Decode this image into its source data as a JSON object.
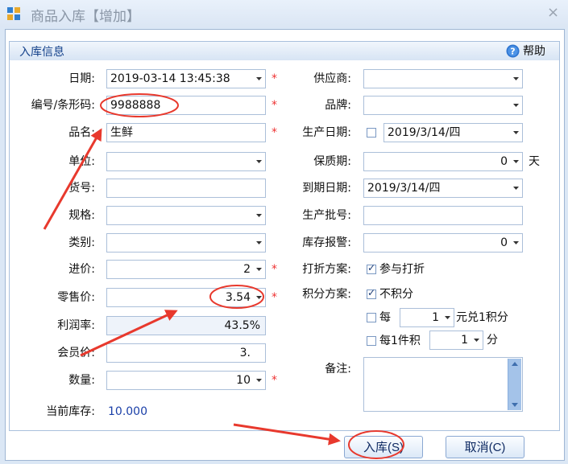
{
  "window": {
    "title": "商品入库【增加】",
    "close_glyph": "×"
  },
  "group": {
    "title": "入库信息",
    "help_label": "帮助"
  },
  "required_mark": "*",
  "left": {
    "date": {
      "label": "日期:",
      "value": "2019-03-14 13:45:38"
    },
    "barcode": {
      "label": "编号/条形码:",
      "value": "9988888"
    },
    "name": {
      "label": "品名:",
      "value": "生鲜"
    },
    "unit": {
      "label": "单位:",
      "value": ""
    },
    "item_no": {
      "label": "货号:",
      "value": ""
    },
    "spec": {
      "label": "规格:",
      "value": ""
    },
    "category": {
      "label": "类别:",
      "value": ""
    },
    "cost_price": {
      "label": "进价:",
      "value": "2"
    },
    "retail_price": {
      "label": "零售价:",
      "value": "3.54"
    },
    "profit_rate": {
      "label": "利润率:",
      "value": "43.5%"
    },
    "member_price": {
      "label": "会员价:",
      "value": "3."
    },
    "quantity": {
      "label": "数量:",
      "value": "10"
    },
    "current_stock": {
      "label": "当前库存:",
      "value": "10.000"
    }
  },
  "right": {
    "supplier": {
      "label": "供应商:",
      "value": ""
    },
    "brand": {
      "label": "品牌:",
      "value": ""
    },
    "production_date": {
      "label": "生产日期:",
      "value": "2019/3/14/四",
      "checked": false
    },
    "shelf_life": {
      "label": "保质期:",
      "value": "0",
      "unit": "天"
    },
    "expiry_date": {
      "label": "到期日期:",
      "value": "2019/3/14/四"
    },
    "batch_no": {
      "label": "生产批号:",
      "value": ""
    },
    "stock_alert": {
      "label": "库存报警:",
      "value": "0"
    },
    "discount_plan": {
      "label": "打折方案:",
      "option": "参与打折",
      "checked": true
    },
    "points_plan": {
      "label": "积分方案:",
      "option": "不积分",
      "checked": true
    },
    "points_per_yuan": {
      "prefix": "每",
      "value": "1",
      "suffix": "元兑1积分",
      "checked": false
    },
    "points_per_item": {
      "prefix": "每1件积",
      "value": "1",
      "suffix": "分",
      "checked": false
    },
    "remarks": {
      "label": "备注:",
      "value": ""
    }
  },
  "buttons": {
    "submit": "入库(S)",
    "cancel": "取消(C)"
  },
  "colors": {
    "annotation": "#e8392d",
    "accent": "#15428b",
    "stock_value": "#1a3fa8"
  }
}
